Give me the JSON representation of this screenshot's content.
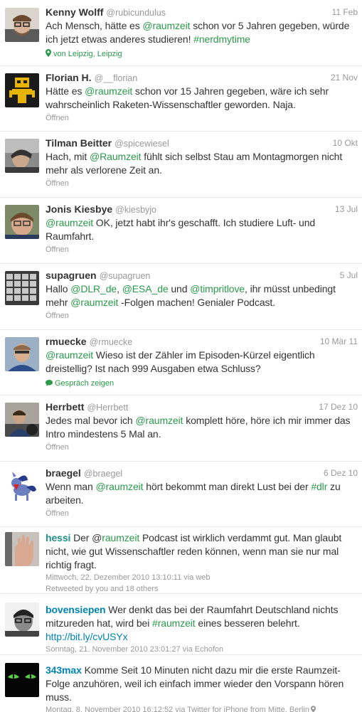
{
  "tweets": [
    {
      "name": "Kenny Wolff",
      "handle": "@rubicundulus",
      "time": "11 Feb",
      "text": [
        {
          "t": "Ach Mensch, hätte es ",
          "k": "plain"
        },
        {
          "t": "@raumzeit",
          "k": "ment"
        },
        {
          "t": " schon vor 5 Jahren gegeben, würde ich jetzt etwas anderes studieren! ",
          "k": "plain"
        },
        {
          "t": "#nerdmytime",
          "k": "hash"
        }
      ],
      "meta": "von Leipzig, Leipzig",
      "meta_icon": "map-pin-icon"
    },
    {
      "name": "Florian H.",
      "handle": "@__florian",
      "time": "21 Nov",
      "text": [
        {
          "t": "Hätte es ",
          "k": "plain"
        },
        {
          "t": "@raumzeit",
          "k": "ment"
        },
        {
          "t": " schon vor 15 Jahren gegeben, wäre ich sehr wahrscheinlich Raketen-Wissenschaftler geworden. Naja.",
          "k": "plain"
        }
      ],
      "meta": "Öffnen"
    },
    {
      "name": "Tilman Beitter",
      "handle": "@spicewiesel",
      "time": "10 Okt",
      "text": [
        {
          "t": "Hach, mit ",
          "k": "plain"
        },
        {
          "t": "@Raumzeit",
          "k": "ment"
        },
        {
          "t": " fühlt sich selbst Stau am Montagmorgen nicht mehr als verlorene Zeit an.",
          "k": "plain"
        }
      ],
      "meta": "Öffnen"
    },
    {
      "name": "Jonis Kiesbye",
      "handle": "@kiesbyjo",
      "time": "13 Jul",
      "text": [
        {
          "t": "@raumzeit",
          "k": "ment"
        },
        {
          "t": " OK, jetzt habt ihr's geschafft. Ich studiere Luft- und Raumfahrt.",
          "k": "plain"
        }
      ],
      "meta": "Öffnen"
    },
    {
      "name": "supagruen",
      "handle": "@supagruen",
      "time": "5 Jul",
      "text": [
        {
          "t": "Hallo ",
          "k": "plain"
        },
        {
          "t": "@DLR_de",
          "k": "ment"
        },
        {
          "t": ", ",
          "k": "plain"
        },
        {
          "t": "@ESA_de",
          "k": "ment"
        },
        {
          "t": " und ",
          "k": "plain"
        },
        {
          "t": "@timpritlove",
          "k": "ment"
        },
        {
          "t": ", ihr müsst unbedingt mehr ",
          "k": "plain"
        },
        {
          "t": "@raumzeit",
          "k": "ment"
        },
        {
          "t": " -Folgen machen! Genialer Podcast.",
          "k": "plain"
        }
      ],
      "meta": "Öffnen"
    },
    {
      "name": "rmuecke",
      "handle": "@rmuecke",
      "time": "10 Mär 11",
      "text": [
        {
          "t": "@raumzeit",
          "k": "ment"
        },
        {
          "t": " Wieso ist der Zähler im Episoden-Kürzel eigentlich dreistellig? Ist nach 999 Ausgaben etwa Schluss?",
          "k": "plain"
        }
      ],
      "meta": "Gespräch zeigen",
      "meta_icon": "conversation-icon"
    },
    {
      "name": "Herrbett",
      "handle": "@Herrbett",
      "time": "17 Dez 10",
      "text": [
        {
          "t": "Jedes mal bevor ich ",
          "k": "plain"
        },
        {
          "t": "@raumzeit",
          "k": "ment"
        },
        {
          "t": " komplett höre, höre ich mir immer das Intro mindestens 5 Mal an.",
          "k": "plain"
        }
      ],
      "meta": "Öffnen"
    },
    {
      "name": "braegel",
      "handle": "@braegel",
      "time": "6 Dez 10",
      "text": [
        {
          "t": "Wenn man ",
          "k": "plain"
        },
        {
          "t": "@raumzeit",
          "k": "ment"
        },
        {
          "t": " hört bekommt man direkt Lust bei der ",
          "k": "plain"
        },
        {
          "t": "#dlr",
          "k": "hash"
        },
        {
          "t": " zu arbeiten.",
          "k": "plain"
        }
      ],
      "meta": "Öffnen"
    }
  ],
  "old_tweets": [
    {
      "user": "hessi",
      "text": [
        {
          "t": " Der @",
          "k": "plain"
        },
        {
          "t": "raumzeit",
          "k": "ment"
        },
        {
          "t": " Podcast ist wirklich verdammt gut. Man glaubt nicht, wie gut Wissenschaftler reden können, wenn man sie nur mal richtig fragt.",
          "k": "plain"
        }
      ],
      "date": "Mittwoch, 22. Dezember 2010 13:10:11",
      "via": " via web",
      "extra": "Retweeted by you and 18 others"
    },
    {
      "user": "bovensiepen",
      "text": [
        {
          "t": " Wer denkt das bei der Raumfahrt Deutschland nichts mitzureden hat, wird bei ",
          "k": "plain"
        },
        {
          "t": "#raumzeit",
          "k": "hash"
        },
        {
          "t": " eines besseren belehrt. ",
          "k": "plain"
        },
        {
          "t": "http://bit.ly/cvUSYx",
          "k": "link-blue"
        }
      ],
      "date": "Sonntag, 21. November 2010 23:01:27",
      "via": " via Echofon"
    },
    {
      "user": "343max",
      "text": [
        {
          "t": " Komme Seit 10 Minuten nicht dazu mir die erste Raumzeit-Folge anzuhören, weil ich einfach immer wieder den Vorspann hören muss.",
          "k": "plain"
        }
      ],
      "date": "Montag, 8. November 2010 16:12:52",
      "via": " via Twitter for iPhone from Mitte, Berlin"
    }
  ]
}
